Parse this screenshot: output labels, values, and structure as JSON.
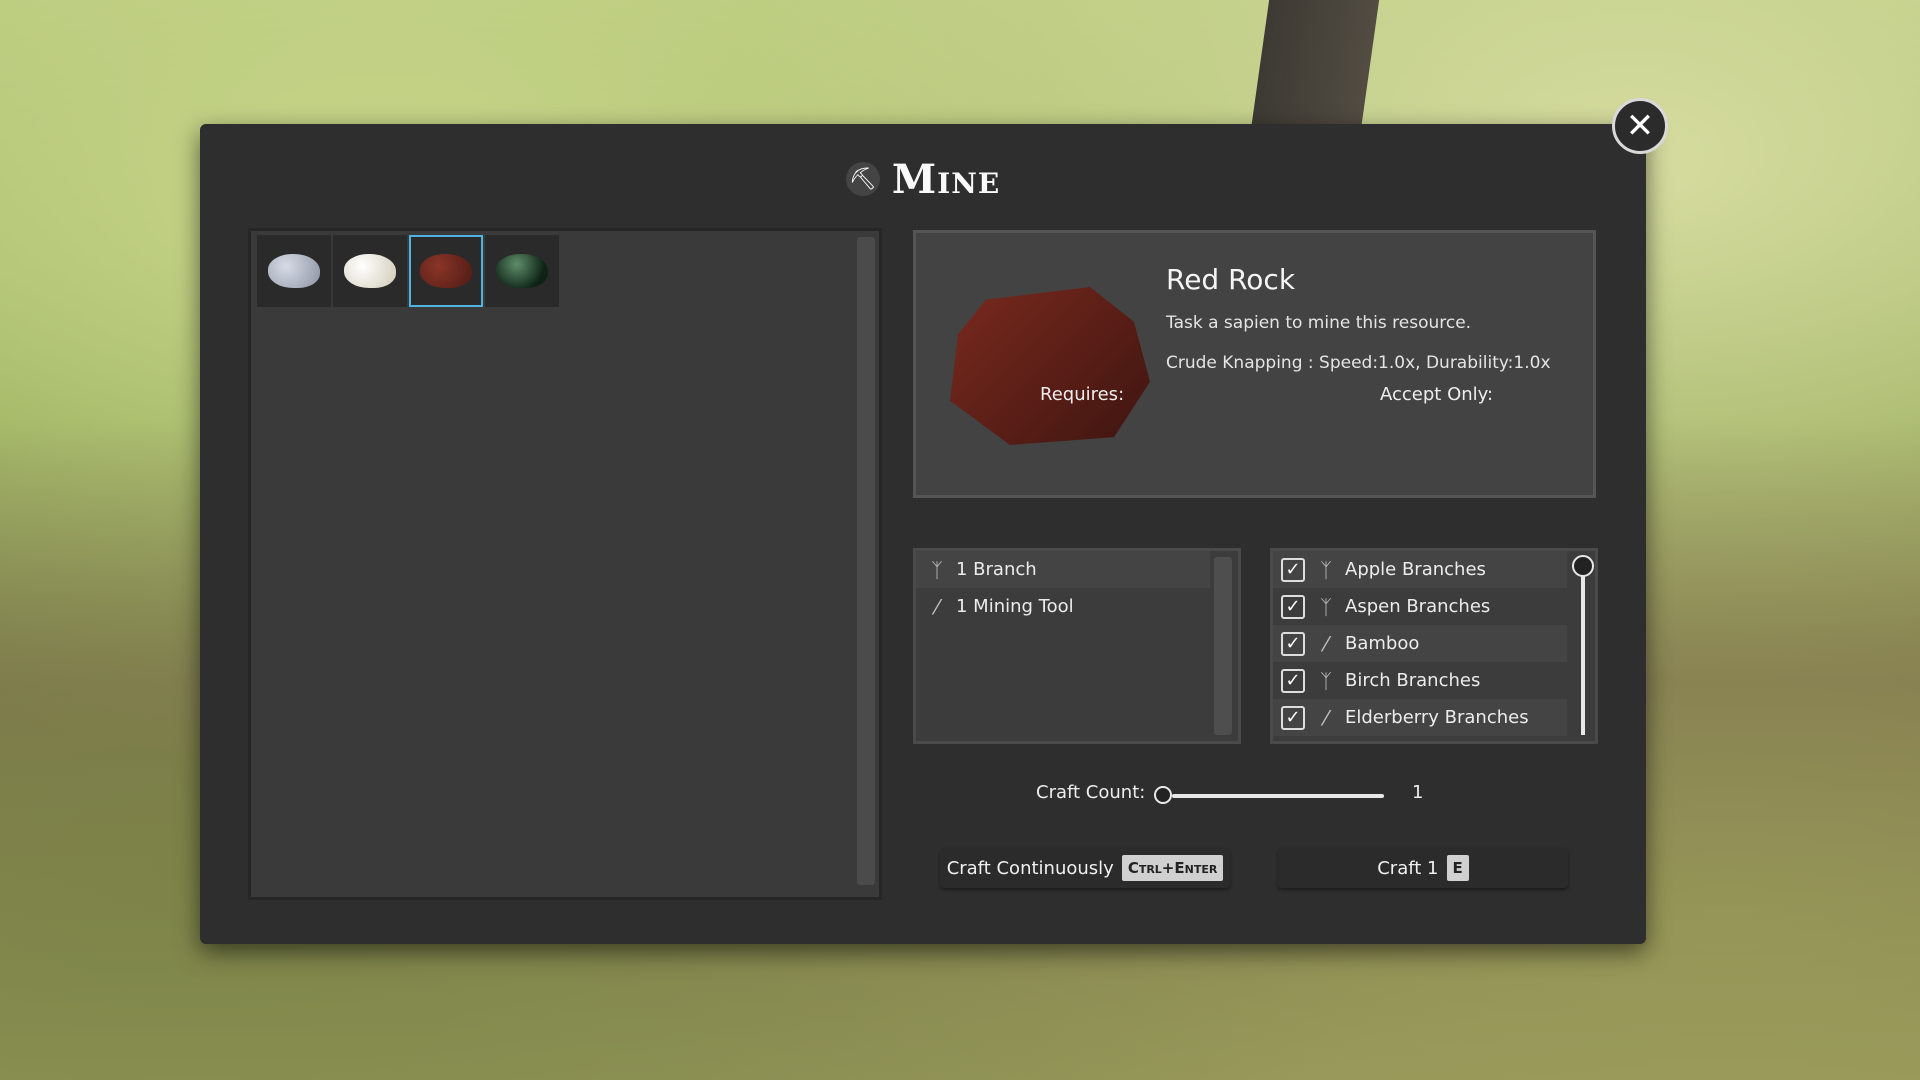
{
  "window": {
    "title": "Mine",
    "title_icon": "pickaxe-icon",
    "close_icon": "close-icon"
  },
  "resources": [
    {
      "name": "grey-rock",
      "color": "#a8adba",
      "selected": false
    },
    {
      "name": "white-rock",
      "color": "#efece0",
      "selected": false
    },
    {
      "name": "red-rock",
      "color": "#6e261c",
      "selected": true
    },
    {
      "name": "green-rock",
      "color": "#1f3b27",
      "selected": false
    }
  ],
  "detail": {
    "title": "Red Rock",
    "description": "Task a sapien to mine this resource.",
    "knapping": "Crude Knapping : Speed:1.0x, Durability:1.0x"
  },
  "requires": {
    "header": "Requires:",
    "items": [
      {
        "label": "1 Branch",
        "icon": "branch-icon"
      },
      {
        "label": "1 Mining Tool",
        "icon": "mining-tool-icon"
      }
    ]
  },
  "accept_only": {
    "header": "Accept Only:",
    "items": [
      {
        "label": "Apple Branches",
        "checked": true,
        "icon": "branch-icon"
      },
      {
        "label": "Aspen Branches",
        "checked": true,
        "icon": "branch-icon"
      },
      {
        "label": "Bamboo",
        "checked": true,
        "icon": "bamboo-icon"
      },
      {
        "label": "Birch Branches",
        "checked": true,
        "icon": "branch-icon"
      },
      {
        "label": "Elderberry Branches",
        "checked": true,
        "icon": "branch-icon"
      }
    ]
  },
  "craft_count": {
    "label": "Craft Count:",
    "value": "1"
  },
  "buttons": {
    "continuous": {
      "label": "Craft Continuously",
      "key": "Ctrl+Enter"
    },
    "craft": {
      "label": "Craft 1",
      "key": "E"
    }
  },
  "colors": {
    "panel": "#2e2e2e",
    "selection": "#4fb3e0",
    "accent_text": "#f0f0f0"
  }
}
